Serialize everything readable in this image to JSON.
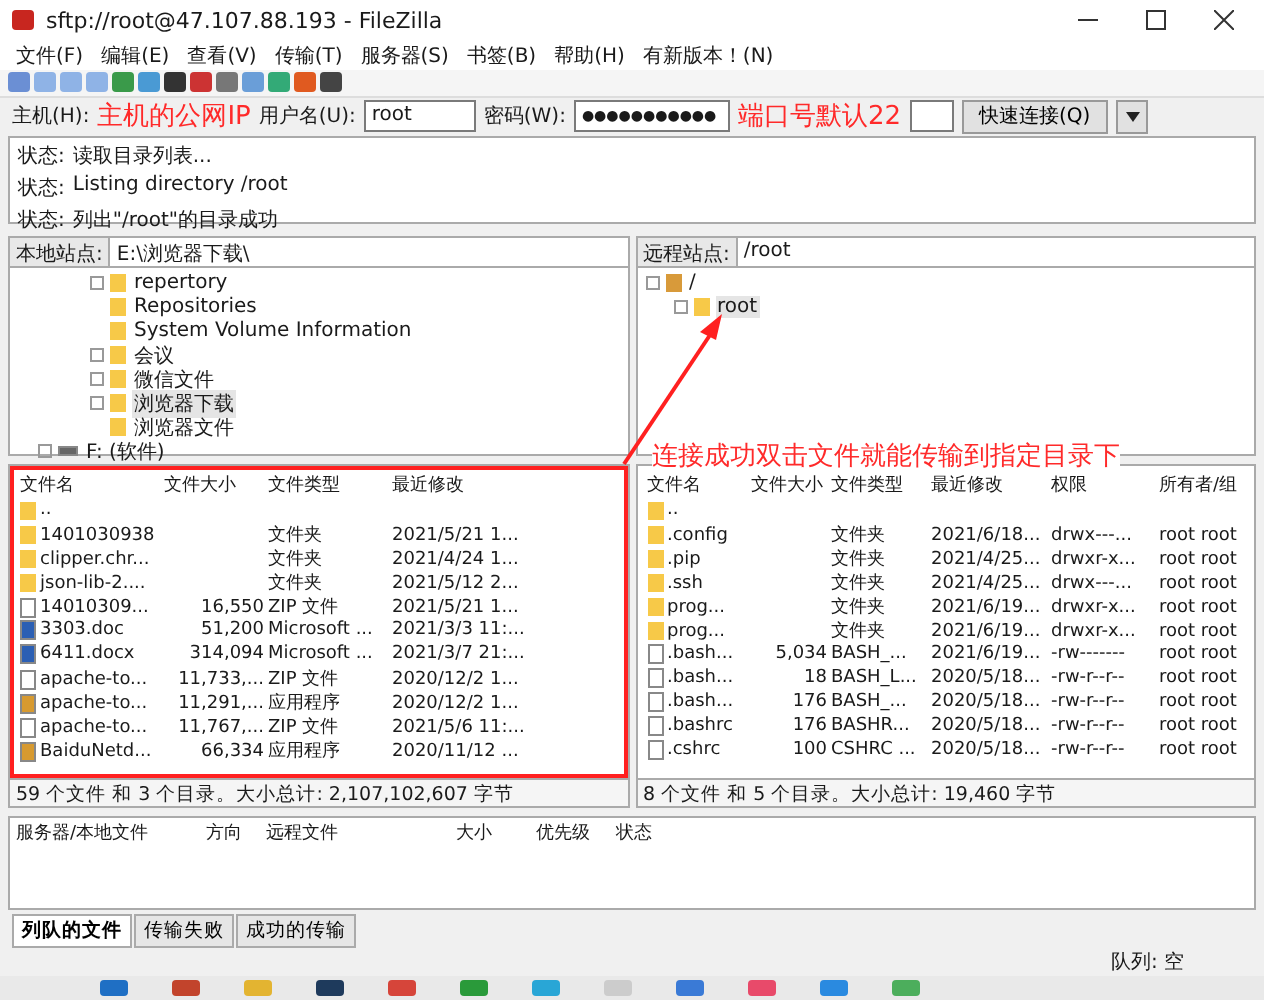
{
  "window": {
    "title": "sftp://root@47.107.88.193 - FileZilla"
  },
  "menu": [
    "文件(F)",
    "编辑(E)",
    "查看(V)",
    "传输(T)",
    "服务器(S)",
    "书签(B)",
    "帮助(H)",
    "有新版本！(N)"
  ],
  "quickconnect": {
    "host_label": "主机(H):",
    "username_label": "用户名(U):",
    "username_value": "root",
    "password_label": "密码(W):",
    "password_value": "●●●●●●●●●●●",
    "connect_button": "快速连接(Q)"
  },
  "annotations": {
    "host_note": "主机的公网IP",
    "port_note": "端口号默认22",
    "transfer_note": "连接成功双击文件就能传输到指定目录下"
  },
  "log": [
    {
      "label": "状态:",
      "text": "读取目录列表..."
    },
    {
      "label": "状态:",
      "text": "Listing directory /root"
    },
    {
      "label": "状态:",
      "text": "列出\"/root\"的目录成功"
    }
  ],
  "local": {
    "site_label": "本地站点:",
    "path": "E:\\浏览器下载\\",
    "tree": [
      {
        "label": "repertory",
        "kind": "folder",
        "expandable": true,
        "selected": false
      },
      {
        "label": "Repositories",
        "kind": "folder",
        "expandable": false,
        "selected": false
      },
      {
        "label": "System Volume Information",
        "kind": "folder",
        "expandable": false,
        "selected": false
      },
      {
        "label": "会议",
        "kind": "folder",
        "expandable": true,
        "selected": false
      },
      {
        "label": "微信文件",
        "kind": "folder",
        "expandable": true,
        "selected": false
      },
      {
        "label": "浏览器下载",
        "kind": "folder",
        "expandable": true,
        "selected": true
      },
      {
        "label": "浏览器文件",
        "kind": "folder",
        "expandable": false,
        "selected": false
      },
      {
        "label": "F: (软件)",
        "kind": "drive",
        "expandable": true,
        "selected": false
      }
    ],
    "columns": [
      "文件名",
      "文件大小",
      "文件类型",
      "最近修改"
    ],
    "rows": [
      {
        "kind": "folder",
        "cells": [
          "..",
          "",
          "",
          ""
        ]
      },
      {
        "kind": "folder",
        "cells": [
          "1401030938",
          "",
          "文件夹",
          "2021/5/21 1..."
        ]
      },
      {
        "kind": "folder",
        "cells": [
          "clipper.chr...",
          "",
          "文件夹",
          "2021/4/24 1..."
        ]
      },
      {
        "kind": "folder",
        "cells": [
          "json-lib-2....",
          "",
          "文件夹",
          "2021/5/12 2..."
        ]
      },
      {
        "kind": "file",
        "cells": [
          "14010309...",
          "16,550",
          "ZIP 文件",
          "2021/5/21 1..."
        ]
      },
      {
        "kind": "document",
        "cells": [
          "3303.doc",
          "51,200",
          "Microsoft ...",
          "2021/3/3 11:..."
        ]
      },
      {
        "kind": "document",
        "cells": [
          "6411.docx",
          "314,094",
          "Microsoft ...",
          "2021/3/7 21:..."
        ]
      },
      {
        "kind": "file",
        "cells": [
          "apache-to...",
          "11,733,...",
          "ZIP 文件",
          "2020/12/2 1..."
        ]
      },
      {
        "kind": "app",
        "cells": [
          "apache-to...",
          "11,291,...",
          "应用程序",
          "2020/12/2 1..."
        ]
      },
      {
        "kind": "file",
        "cells": [
          "apache-to...",
          "11,767,...",
          "ZIP 文件",
          "2021/5/6 11:..."
        ]
      },
      {
        "kind": "app",
        "cells": [
          "BaiduNetd...",
          "66,334",
          "应用程序",
          "2020/11/12 ..."
        ]
      }
    ],
    "summary": "59 个文件 和 3 个目录。大小总计: 2,107,102,607 字节"
  },
  "remote": {
    "site_label": "远程站点:",
    "path": "/root",
    "tree": [
      {
        "label": "/",
        "kind": "unknown",
        "expandable": true,
        "selected": false,
        "children": [
          {
            "label": "root",
            "kind": "folder",
            "expandable": true,
            "selected": true
          }
        ]
      }
    ],
    "columns": [
      "文件名",
      "文件大小",
      "文件类型",
      "最近修改",
      "权限",
      "所有者/组"
    ],
    "rows": [
      {
        "kind": "folder",
        "cells": [
          "..",
          "",
          "",
          "",
          "",
          ""
        ]
      },
      {
        "kind": "folder",
        "cells": [
          ".config",
          "",
          "文件夹",
          "2021/6/18...",
          "drwx---...",
          "root root"
        ]
      },
      {
        "kind": "folder",
        "cells": [
          ".pip",
          "",
          "文件夹",
          "2021/4/25...",
          "drwxr-x...",
          "root root"
        ]
      },
      {
        "kind": "folder",
        "cells": [
          ".ssh",
          "",
          "文件夹",
          "2021/4/25...",
          "drwx---...",
          "root root"
        ]
      },
      {
        "kind": "folder",
        "cells": [
          "prog...",
          "",
          "文件夹",
          "2021/6/19...",
          "drwxr-x...",
          "root root"
        ]
      },
      {
        "kind": "folder",
        "cells": [
          "prog...",
          "",
          "文件夹",
          "2021/6/19...",
          "drwxr-x...",
          "root root"
        ]
      },
      {
        "kind": "file",
        "cells": [
          ".bash...",
          "5,034",
          "BASH_...",
          "2021/6/19...",
          "-rw-------",
          "root root"
        ]
      },
      {
        "kind": "file",
        "cells": [
          ".bash...",
          "18",
          "BASH_L...",
          "2020/5/18...",
          "-rw-r--r--",
          "root root"
        ]
      },
      {
        "kind": "file",
        "cells": [
          ".bash...",
          "176",
          "BASH_...",
          "2020/5/18...",
          "-rw-r--r--",
          "root root"
        ]
      },
      {
        "kind": "file",
        "cells": [
          ".bashrc",
          "176",
          "BASHR...",
          "2020/5/18...",
          "-rw-r--r--",
          "root root"
        ]
      },
      {
        "kind": "file",
        "cells": [
          ".cshrc",
          "100",
          "CSHRC ...",
          "2020/5/18...",
          "-rw-r--r--",
          "root root"
        ]
      }
    ],
    "summary": "8 个文件 和 5 个目录。大小总计: 19,460 字节"
  },
  "queue": {
    "columns": [
      "服务器/本地文件",
      "方向",
      "远程文件",
      "大小",
      "优先级",
      "状态"
    ]
  },
  "queue_tabs": [
    {
      "label": "列队的文件",
      "selected": true
    },
    {
      "label": "传输失败",
      "selected": false
    },
    {
      "label": "成功的传输",
      "selected": false
    }
  ],
  "status_bar": {
    "queue": "队列: 空"
  }
}
